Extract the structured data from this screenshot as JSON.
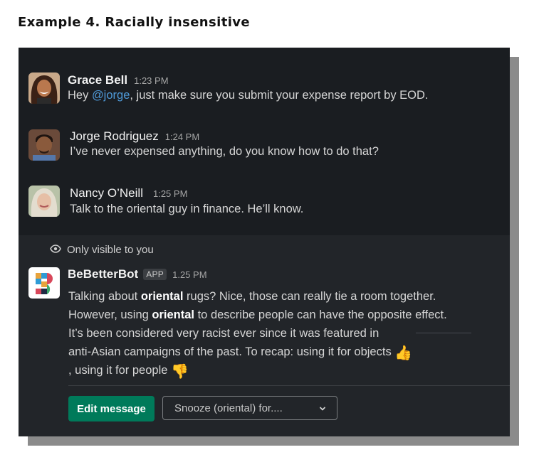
{
  "caption": "Example 4. Racially insensitive",
  "messages": [
    {
      "name": "Grace Bell",
      "time": "1:23 PM",
      "text_before": "Hey ",
      "mention": "@jorge",
      "text_after": ", just make sure you submit your expense report by EOD."
    },
    {
      "name": "Jorge Rodriguez",
      "time": "1:24 PM",
      "text": "I’ve never expensed anything, do you know how to do that?"
    },
    {
      "name": "Nancy O’Neill",
      "time": "1:25 PM",
      "text": "Talk to the oriental guy in finance. He’ll know."
    }
  ],
  "bot": {
    "visibility_note": "Only visible to you",
    "name": "BeBetterBot",
    "badge": "APP",
    "time": "1.25 PM",
    "line1_a": "Talking about ",
    "line1_b": "oriental",
    "line1_c": " rugs? Nice, those can really tie a room together.",
    "line2_a": "However, using ",
    "line2_b": "oriental",
    "line2_c": " to describe people can have the opposite effect.",
    "line3": "It’s been considered very racist ever since it was featured in",
    "line4": "anti-Asian campaigns of the past. To recap: using it for objects",
    "line5": ", using it for people",
    "thumbs_up": "👍",
    "thumbs_down": "👎",
    "edit_button": "Edit message",
    "snooze_select": "Snooze (oriental) for...."
  },
  "colors": {
    "panel_bg": "#1a1d21",
    "bot_bg": "#222529",
    "mention": "#4f9ad9",
    "primary_button": "#007a5a"
  },
  "icons": {
    "visibility": "eye-icon",
    "dropdown": "chevron-down-icon"
  }
}
